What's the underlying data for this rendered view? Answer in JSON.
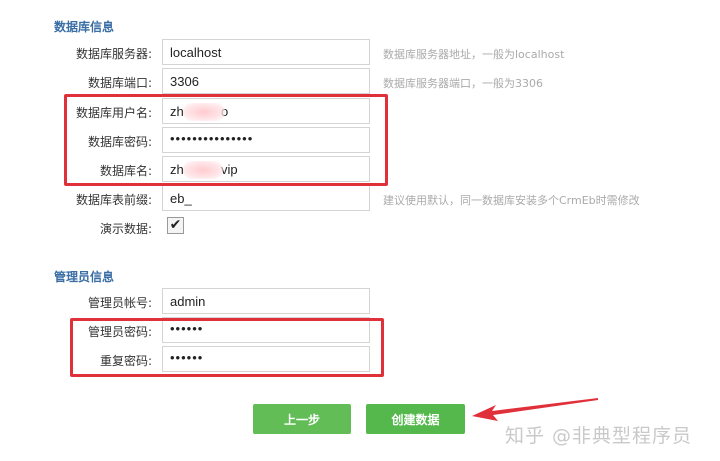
{
  "db_section": {
    "title": "数据库信息",
    "rows": [
      {
        "label": "数据库服务器:",
        "value": "localhost",
        "hint": "数据库服务器地址，一般为localhost"
      },
      {
        "label": "数据库端口:",
        "value": "3306",
        "hint": "数据库服务器端口，一般为3306"
      },
      {
        "label": "数据库用户名:",
        "value": "zh",
        "value_tail": "o"
      },
      {
        "label": "数据库密码:",
        "value": "•••••••••••••••"
      },
      {
        "label": "数据库名:",
        "value": "zh",
        "value_tail": "vip"
      },
      {
        "label": "数据库表前缀:",
        "value": "eb_",
        "hint": "建议使用默认，同一数据库安装多个CrmEb时需修改"
      },
      {
        "label": "演示数据:",
        "checked_glyph": "✔"
      }
    ]
  },
  "admin_section": {
    "title": "管理员信息",
    "rows": [
      {
        "label": "管理员帐号:",
        "value": "admin"
      },
      {
        "label": "管理员密码:",
        "value": "••••••"
      },
      {
        "label": "重复密码:",
        "value": "••••••"
      }
    ]
  },
  "buttons": {
    "prev_label": "上一步",
    "create_label": "创建数据"
  },
  "watermark": "知乎 @非典型程序员",
  "colors": {
    "section_title": "#3a6ea5",
    "button_green": "#5cb85c",
    "highlight_red": "#e0303a",
    "hint_gray": "#aaaaaa"
  }
}
